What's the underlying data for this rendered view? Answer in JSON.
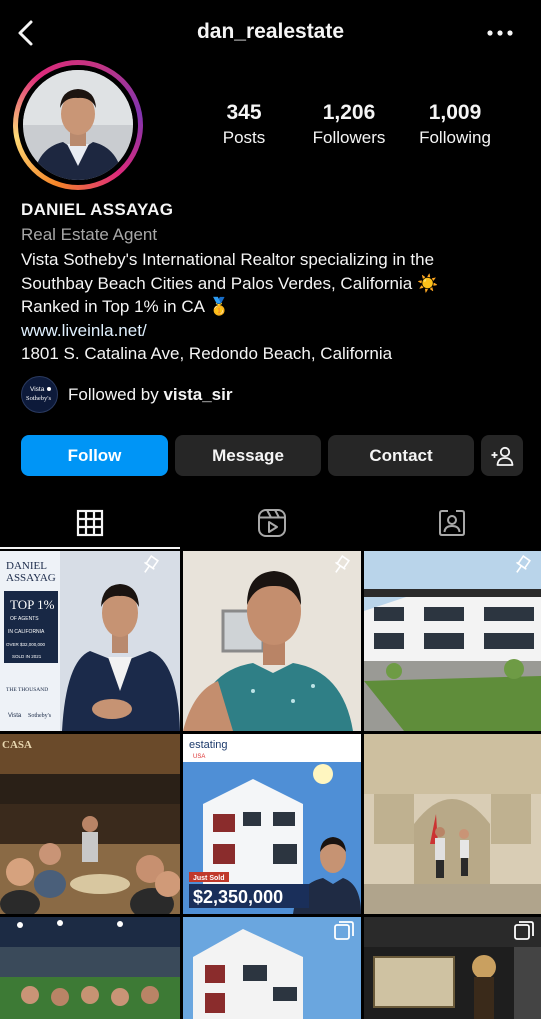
{
  "header": {
    "username": "dan_realestate",
    "back_icon": "chevron-left-icon",
    "more_icon": "ellipsis-icon"
  },
  "profile": {
    "stats": [
      {
        "count": "345",
        "label": "Posts"
      },
      {
        "count": "1,206",
        "label": "Followers"
      },
      {
        "count": "1,009",
        "label": "Following"
      }
    ],
    "name": "DANIEL ASSAYAG",
    "category": "Real Estate Agent",
    "bio": {
      "line1": "Vista Sotheby's International Realtor specializing in the",
      "line2": "Southbay Beach Cities and Palos Verdes, California ☀️",
      "line3": "Ranked in Top 1% in CA 🥇"
    },
    "website": "www.liveinla.net/",
    "address": "1801 S. Catalina Ave, Redondo Beach, California",
    "followed_by": {
      "prefix": "Followed by",
      "user": "vista_sir",
      "avatar_text_top": "Vista",
      "avatar_text_bottom": "Sotheby's"
    }
  },
  "actions": {
    "follow": "Follow",
    "message": "Message",
    "contact": "Contact",
    "add_user_icon": "add-person-icon"
  },
  "tabs": [
    {
      "name": "posts-grid",
      "icon": "grid-icon",
      "active": true
    },
    {
      "name": "reels",
      "icon": "reels-icon",
      "active": false
    },
    {
      "name": "tagged",
      "icon": "tagged-person-icon",
      "active": false
    }
  ],
  "posts": {
    "p1": {
      "title_line1": "DANIEL",
      "title_line2": "ASSAYAG",
      "top": "TOP 1%",
      "of_agents": "OF AGENTS",
      "in_ca": "IN CALIFORNIA",
      "over": "OVER $32,000,000",
      "sold": "SOLD IN 2021",
      "thousand": "THE THOUSAND",
      "vista": "Vista",
      "sothebys": "Sotheby's"
    },
    "p5": {
      "brand": "estating",
      "brand_sub": "USA",
      "just_sold": "Just Sold",
      "price": "$2,350,000"
    },
    "p4": {
      "sign": "CASA"
    }
  },
  "colors": {
    "background": "#000000",
    "follow_button": "#0095f6",
    "secondary_button": "#262626",
    "muted_text": "#a8a8a8"
  }
}
